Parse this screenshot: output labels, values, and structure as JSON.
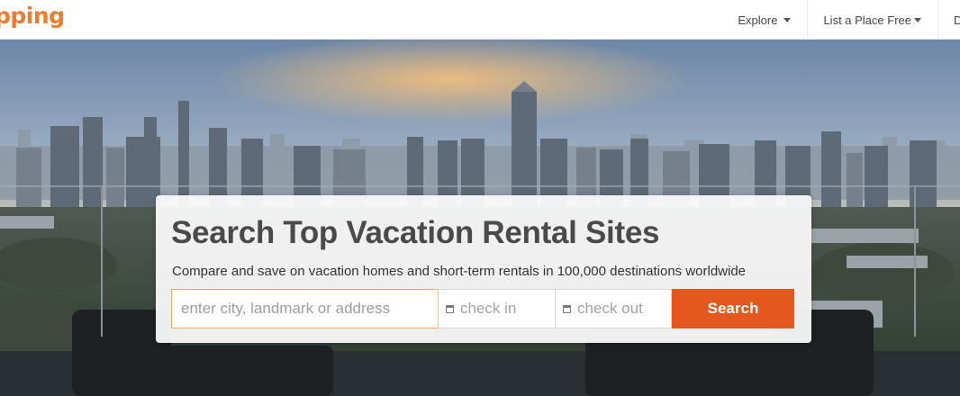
{
  "brand": {
    "logo_text": "pping"
  },
  "nav": {
    "items": [
      {
        "label": "Explore",
        "has_dropdown": true
      },
      {
        "label": "List a Place Free",
        "has_dropdown": true
      },
      {
        "label": "De",
        "has_dropdown": false
      }
    ]
  },
  "hero": {
    "headline": "Search Top Vacation Rental Sites",
    "tagline": "Compare and save on vacation homes and short-term rentals in 100,000 destinations worldwide"
  },
  "search": {
    "location_placeholder": "enter city, landmark or address",
    "checkin_placeholder": "check in",
    "checkout_placeholder": "check out",
    "button_label": "Search",
    "calendar_icon": "calendar-icon"
  },
  "colors": {
    "brand": "#ef7b2c",
    "search_button": "#e4581e",
    "focus_border": "#f2a463"
  }
}
